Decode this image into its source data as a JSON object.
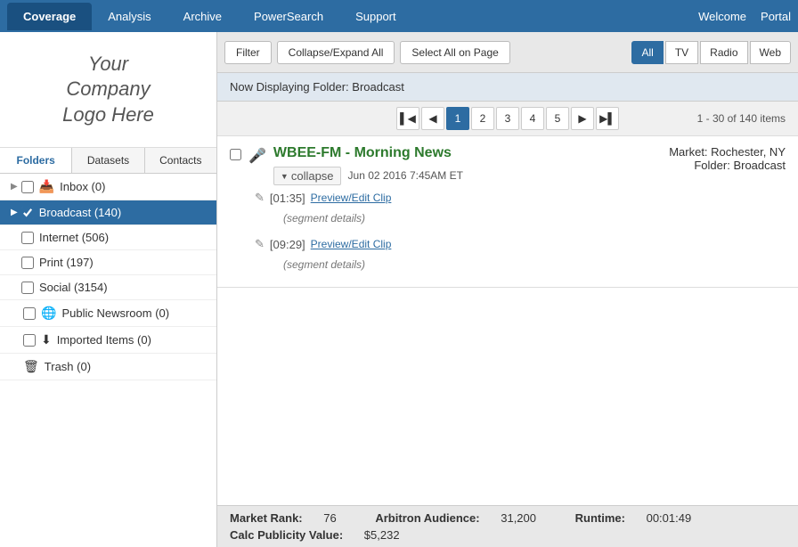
{
  "nav": {
    "tabs": [
      {
        "label": "Coverage",
        "active": true
      },
      {
        "label": "Analysis",
        "active": false
      },
      {
        "label": "Archive",
        "active": false
      },
      {
        "label": "PowerSearch",
        "active": false
      },
      {
        "label": "Support",
        "active": false
      }
    ],
    "welcome": "Welcome",
    "portal": "Portal"
  },
  "sidebar": {
    "logo_line1": "Your",
    "logo_line2": "Company",
    "logo_line3": "Logo Here",
    "tabs": [
      {
        "label": "Folders",
        "active": true
      },
      {
        "label": "Datasets",
        "active": false
      },
      {
        "label": "Contacts",
        "active": false
      }
    ],
    "folders": [
      {
        "label": "Inbox (0)",
        "icon": "inbox",
        "indent": 1,
        "active": false,
        "has_checkbox": true
      },
      {
        "label": "Broadcast (140)",
        "icon": "broadcast",
        "indent": 1,
        "active": true,
        "has_checkbox": true
      },
      {
        "label": "Internet (506)",
        "icon": "",
        "indent": 2,
        "active": false,
        "has_checkbox": true
      },
      {
        "label": "Print (197)",
        "icon": "",
        "indent": 2,
        "active": false,
        "has_checkbox": true
      },
      {
        "label": "Social (3154)",
        "icon": "",
        "indent": 2,
        "active": false,
        "has_checkbox": true
      },
      {
        "label": "Public Newsroom (0)",
        "icon": "globe",
        "indent": 1,
        "active": false,
        "has_checkbox": true
      },
      {
        "label": "Imported Items (0)",
        "icon": "import",
        "indent": 1,
        "active": false,
        "has_checkbox": true
      },
      {
        "label": "Trash (0)",
        "icon": "trash",
        "indent": 1,
        "active": false,
        "has_checkbox": false
      }
    ]
  },
  "toolbar": {
    "filter_label": "Filter",
    "collapse_expand_label": "Collapse/Expand All",
    "select_all_label": "Select All on Page",
    "filter_tabs": [
      {
        "label": "All",
        "active": true
      },
      {
        "label": "TV",
        "active": false
      },
      {
        "label": "Radio",
        "active": false
      },
      {
        "label": "Web",
        "active": false
      }
    ]
  },
  "folder_display": {
    "text": "Now Displaying Folder: Broadcast"
  },
  "pagination": {
    "current": 1,
    "pages": [
      1,
      2,
      3,
      4,
      5
    ],
    "info": "1 - 30 of 140 items"
  },
  "items": [
    {
      "title": "WBEE-FM - Morning News",
      "date": "Jun 02 2016 7:45AM ET",
      "market_label": "Market:",
      "market_value": "Rochester, NY",
      "folder_label": "Folder:",
      "folder_value": "Broadcast",
      "collapse_label": "collapse",
      "segments": [
        {
          "time": "[01:35]",
          "link_label": "Preview/Edit Clip",
          "details": "(segment details)"
        },
        {
          "time": "[09:29]",
          "link_label": "Preview/Edit Clip",
          "details": "(segment details)"
        }
      ]
    }
  ],
  "item_stats": {
    "market_rank_label": "Market Rank:",
    "market_rank_value": "76",
    "arbitron_label": "Arbitron Audience:",
    "arbitron_value": "31,200",
    "runtime_label": "Runtime:",
    "runtime_value": "00:01:49",
    "calc_label": "Calc Publicity Value:",
    "calc_value": "$5,232"
  }
}
